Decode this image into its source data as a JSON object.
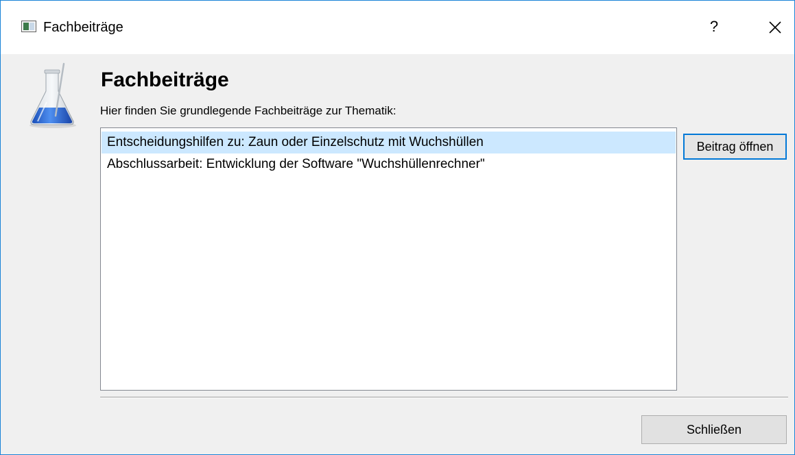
{
  "window": {
    "title": "Fachbeiträge",
    "help_label": "?",
    "close_icon": "close-icon"
  },
  "header": {
    "icon": "flask-icon",
    "heading": "Fachbeiträge",
    "description": "Hier finden Sie grundlegende Fachbeiträge zur Thematik:"
  },
  "articles": {
    "items": [
      {
        "label": "Entscheidungshilfen zu: Zaun oder Einzelschutz mit Wuchshüllen",
        "selected": true
      },
      {
        "label": "Abschlussarbeit: Entwicklung der Software \"Wuchshüllenrechner\"",
        "selected": false
      }
    ]
  },
  "buttons": {
    "open_label": "Beitrag öffnen",
    "close_label": "Schließen"
  },
  "colors": {
    "accent": "#0078d7",
    "selection": "#cce8ff",
    "window_border": "#1883d7"
  }
}
